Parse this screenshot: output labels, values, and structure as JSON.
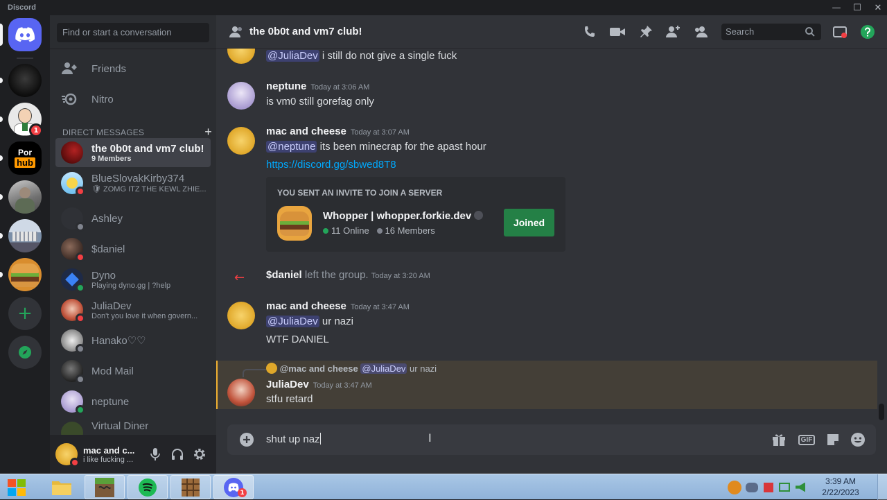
{
  "window": {
    "title": "Discord",
    "minimize": "—",
    "maximize": "☐",
    "close": "✕"
  },
  "colors": {
    "blurple": "#5865f2",
    "green": "#248046",
    "online": "#23a55a",
    "dnd": "#f23f43",
    "idle": "#f0b132",
    "link": "#00a8fc"
  },
  "guilds": [
    {
      "name": "home",
      "icon": "discord-logo-icon"
    },
    {
      "name": "server-dark"
    },
    {
      "name": "server-peter",
      "badge": "1"
    },
    {
      "name": "server-hub"
    },
    {
      "name": "server-photo"
    },
    {
      "name": "server-building"
    },
    {
      "name": "server-burger"
    },
    {
      "name": "add-server",
      "icon": "plus-icon"
    },
    {
      "name": "explore",
      "icon": "compass-icon"
    }
  ],
  "sidebar": {
    "search_placeholder": "Find or start a conversation",
    "nav": [
      {
        "label": "Friends",
        "icon": "friends-icon"
      },
      {
        "label": "Nitro",
        "icon": "nitro-icon"
      }
    ],
    "dm_header": "DIRECT MESSAGES",
    "dm_add": "+",
    "dms": [
      {
        "name": "the 0b0t and vm7 club!",
        "sub": "9 Members",
        "active": true
      },
      {
        "name": "BlueSlovakKirby374",
        "sub": "🛡 ZOMG ITZ THE KEWL ZHIE...",
        "status": "dnd"
      },
      {
        "name": "Ashley",
        "sub": "",
        "status": "offline"
      },
      {
        "name": "$daniel",
        "sub": "",
        "status": "dnd"
      },
      {
        "name": "Dyno",
        "sub": "Playing dyno.gg | ?help",
        "status": "online"
      },
      {
        "name": "JuliaDev",
        "sub": "Don't you love it when govern...",
        "status": "dnd"
      },
      {
        "name": "Hanako♡♡",
        "sub": "",
        "status": "offline"
      },
      {
        "name": "Mod Mail",
        "sub": "",
        "status": "offline"
      },
      {
        "name": "neptune",
        "sub": "",
        "status": "online"
      },
      {
        "name": "Virtual Diner",
        "sub": "",
        "status": "offline"
      }
    ],
    "user": {
      "name": "mac and c...",
      "status": "i like fucking ..."
    }
  },
  "header": {
    "title": "the 0b0t and vm7 club!",
    "search_placeholder": "Search"
  },
  "messages": {
    "m0": {
      "mention": "@JuliaDev",
      "text": " i still do not give a single fuck"
    },
    "m1": {
      "author": "neptune",
      "time": "Today at 3:06 AM",
      "text": "is vm0 still gorefag only"
    },
    "m2": {
      "author": "mac and cheese",
      "time": "Today at 3:07 AM",
      "mention": "@neptune",
      "text": " its been minecrap for the apast  hour",
      "link": "https://discord.gg/sbwed8T8"
    },
    "invite": {
      "heading": "YOU SENT AN INVITE TO JOIN A SERVER",
      "server": "Whopper | whopper.forkie.dev",
      "online": "11 Online",
      "members": "16 Members",
      "button": "Joined"
    },
    "system": {
      "user": "$daniel",
      "text": " left the group.",
      "time": "Today at 3:20 AM"
    },
    "m3": {
      "author": "mac and cheese",
      "time": "Today at 3:47 AM",
      "mention": "@JuliaDev",
      "text": " ur nazi",
      "text2": "WTF DANIEL"
    },
    "m4": {
      "reply_author": "@mac and cheese",
      "reply_mention": "@JuliaDev",
      "reply_text": " ur nazi",
      "author": "JuliaDev",
      "time": "Today at 3:47 AM",
      "text": "stfu retard"
    }
  },
  "composer": {
    "value": "shut up naz"
  },
  "taskbar": {
    "time": "3:39 AM",
    "date": "2/22/2023",
    "discord_badge": "1"
  }
}
